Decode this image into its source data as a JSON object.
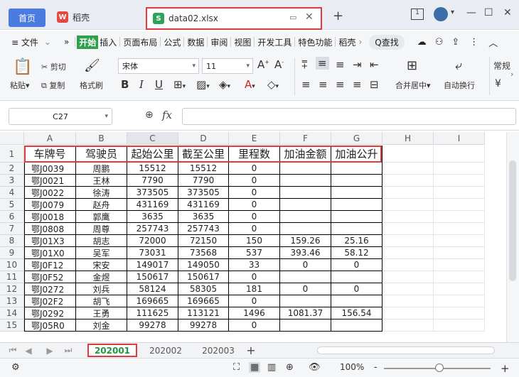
{
  "tabs": {
    "home": "首页",
    "wps": "稻壳",
    "file": "data02.xlsx",
    "new_tab": "+"
  },
  "menu": {
    "file": "≡ 文件",
    "more": "»",
    "items": [
      "开始",
      "插入",
      "页面布局",
      "公式",
      "数据",
      "审阅",
      "视图",
      "开发工具",
      "特色功能",
      "稻壳"
    ],
    "search": "Q查找"
  },
  "ribbon": {
    "paste": "粘贴",
    "cut": "剪切",
    "copy": "复制",
    "format_painter": "格式刷",
    "font_name": "宋体",
    "font_size": "11",
    "merge": "合并居中",
    "wrap": "自动换行",
    "number_format": "常规",
    "currency": "¥"
  },
  "formula": {
    "cell_ref": "C27",
    "fx": "fx",
    "value": ""
  },
  "columns": [
    "A",
    "B",
    "C",
    "D",
    "E",
    "F",
    "G",
    "H",
    "I"
  ],
  "table": {
    "headers": [
      "车牌号",
      "驾驶员",
      "起始公里",
      "截至公里",
      "里程数",
      "加油金额",
      "加油公升"
    ],
    "rows": [
      [
        "鄂J0039",
        "周鹏",
        "15512",
        "15512",
        "0",
        "",
        ""
      ],
      [
        "鄂J0021",
        "王林",
        "7790",
        "7790",
        "0",
        "",
        ""
      ],
      [
        "鄂J0022",
        "徐涛",
        "373505",
        "373505",
        "0",
        "",
        ""
      ],
      [
        "鄂J0079",
        "赵舟",
        "431169",
        "431169",
        "0",
        "",
        ""
      ],
      [
        "鄂J0018",
        "郭鹰",
        "3635",
        "3635",
        "0",
        "",
        ""
      ],
      [
        "鄂J0808",
        "周尊",
        "257743",
        "257743",
        "0",
        "",
        ""
      ],
      [
        "鄂J01X3",
        "胡志",
        "72000",
        "72150",
        "150",
        "159.26",
        "25.16"
      ],
      [
        "鄂J01X0",
        "吴军",
        "73031",
        "73568",
        "537",
        "393.46",
        "58.12"
      ],
      [
        "鄂J0F12",
        "宋安",
        "149017",
        "149050",
        "33",
        "0",
        "0"
      ],
      [
        "鄂J0F52",
        "金煜",
        "150617",
        "150617",
        "0",
        "",
        ""
      ],
      [
        "鄂J0272",
        "刘兵",
        "58124",
        "58305",
        "181",
        "0",
        "0"
      ],
      [
        "鄂J02F2",
        "胡飞",
        "169665",
        "169665",
        "0",
        "",
        ""
      ],
      [
        "鄂J0292",
        "王勇",
        "111625",
        "113121",
        "1496",
        "1081.37",
        "156.54"
      ],
      [
        "鄂J05R0",
        "刘金",
        "99278",
        "99278",
        "0",
        "",
        ""
      ]
    ]
  },
  "row_numbers": [
    "1",
    "2",
    "3",
    "4",
    "5",
    "6",
    "7",
    "8",
    "9",
    "10",
    "11",
    "12",
    "13",
    "14",
    "15"
  ],
  "sheets": [
    "202001",
    "202002",
    "202003"
  ],
  "add_sheet": "+",
  "status": {
    "zoom": "100%",
    "minus": "-",
    "plus": "+"
  }
}
